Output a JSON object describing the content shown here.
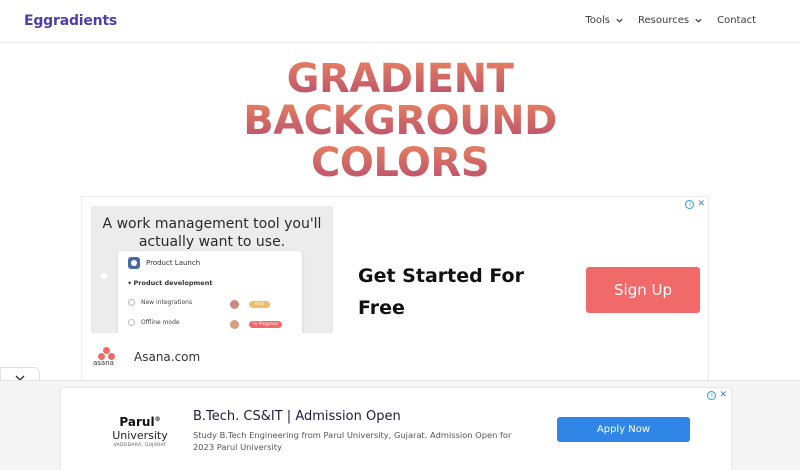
{
  "header": {
    "logo": "Eggradients",
    "nav": [
      {
        "label": "Tools",
        "icon": "chevron-down-icon"
      },
      {
        "label": "Resources",
        "icon": "chevron-down-icon"
      },
      {
        "label": "Contact"
      }
    ]
  },
  "hero": {
    "lines": [
      "GRADIENT",
      "BACKGROUND",
      "COLORS"
    ]
  },
  "ad_top": {
    "image_headline": "A work management tool you'll actually want to use.",
    "card": {
      "title": "Product Launch",
      "section": "Product development",
      "rows": [
        {
          "label": "New integrations",
          "status": "Risk"
        },
        {
          "label": "Offline mode",
          "status": "In Progress"
        }
      ]
    },
    "cta_text": "Get Started For Free",
    "button": "Sign Up",
    "brand_word": "asana",
    "domain": "Asana.com"
  },
  "ad_bottom": {
    "logo_name": "Parul",
    "logo_reg": "®",
    "logo_university": "University",
    "logo_location": "VADODARA, GUJARAT",
    "title": "B.Tech. CS&IT | Admission Open",
    "description": "Study B.Tech Engineering from Parul University, Gujarat. Admission Open for 2023 Parul University",
    "button": "Apply Now"
  },
  "colors": {
    "brand": "#4d3fa6",
    "gradient_start": "#e8825f",
    "gradient_end": "#b84f6e",
    "asana_button": "#f06a6a",
    "apply_button": "#2f86e6"
  }
}
